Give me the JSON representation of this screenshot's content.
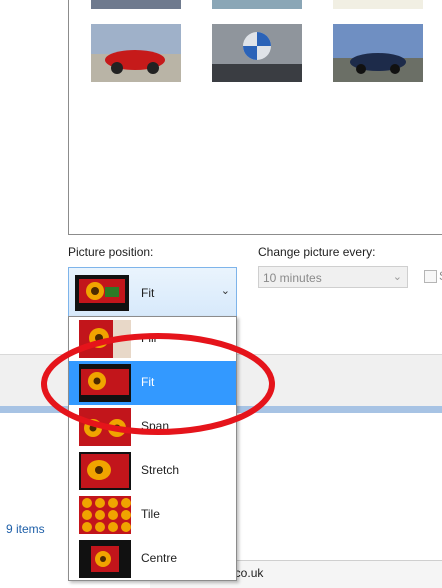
{
  "labels": {
    "picture_position": "Picture position:",
    "change_picture_every": "Change picture every:",
    "shuffle": "S"
  },
  "position_combo": {
    "selected": "Fit"
  },
  "interval_combo": {
    "selected": "10 minutes"
  },
  "dropdown": {
    "options": [
      {
        "label": "Fill"
      },
      {
        "label": "Fit"
      },
      {
        "label": "Span"
      },
      {
        "label": "Stretch"
      },
      {
        "label": "Tile"
      },
      {
        "label": "Centre"
      }
    ],
    "selected_index": 1
  },
  "status": {
    "items": "9 items"
  },
  "address": {
    "text": "…gy . . .e.co.uk"
  },
  "colors": {
    "selection": "#3399ff",
    "annotation": "#e5141b"
  }
}
